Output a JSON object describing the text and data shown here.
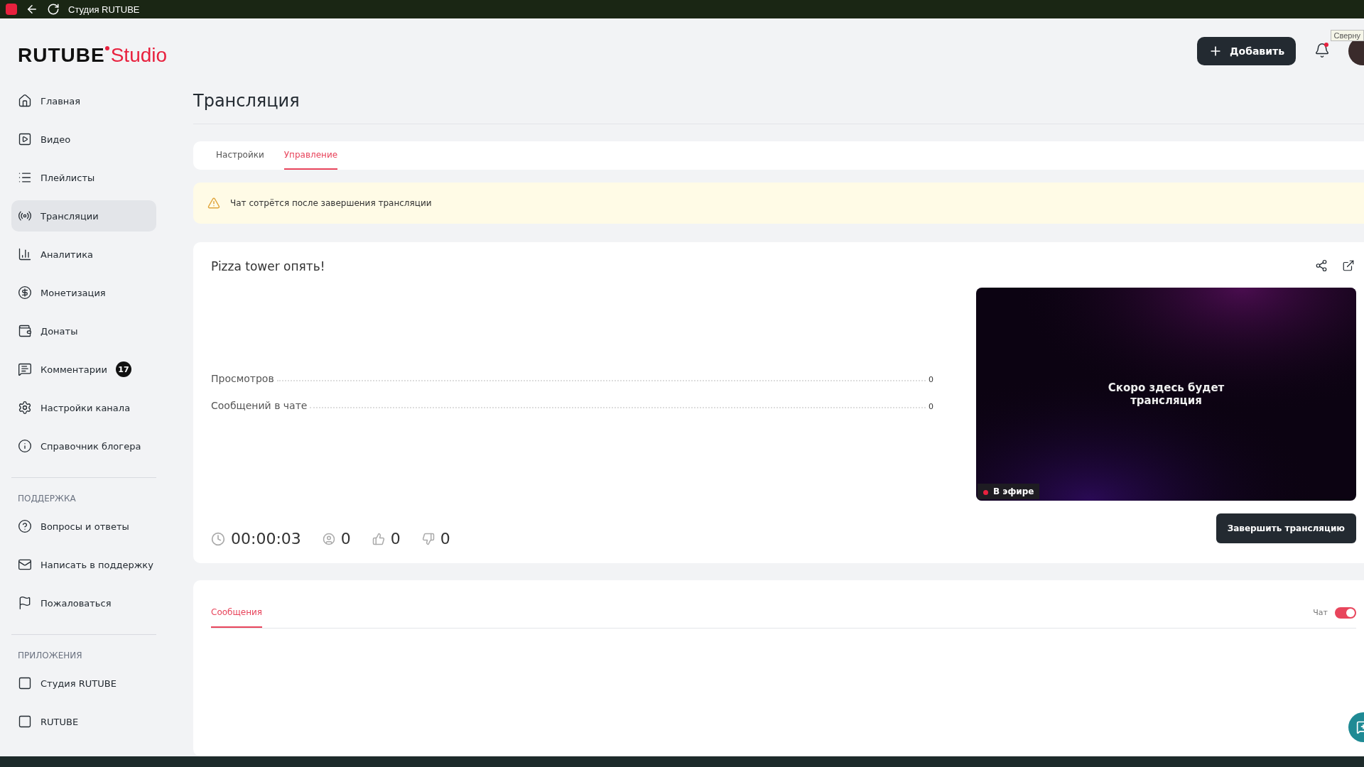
{
  "browser_bar": {
    "title": "Студия RUTUBE",
    "tooltip": "Сверну"
  },
  "header": {
    "logo": {
      "brand": "RUTUBE",
      "product": "Studio"
    },
    "add_button": "Добавить",
    "notifications": {
      "unread": true
    }
  },
  "sidebar": {
    "items": [
      {
        "label": "Главная",
        "selected": false
      },
      {
        "label": "Видео",
        "selected": false
      },
      {
        "label": "Плейлисты",
        "selected": false
      },
      {
        "label": "Трансляции",
        "selected": true
      },
      {
        "label": "Аналитика",
        "selected": false
      },
      {
        "label": "Монетизация",
        "selected": false
      },
      {
        "label": "Донаты",
        "selected": false
      },
      {
        "label": "Комментарии",
        "selected": false,
        "badge": "17"
      },
      {
        "label": "Настройки канала",
        "selected": false
      },
      {
        "label": "Справочник блогера",
        "selected": false
      }
    ],
    "sections": [
      {
        "title": "ПОДДЕРЖКА",
        "items": [
          {
            "label": "Вопросы и ответы",
            "selected": false
          },
          {
            "label": "Написать в поддержку",
            "selected": false
          },
          {
            "label": "Пожаловаться",
            "selected": false
          }
        ]
      },
      {
        "title": "ПРИЛОЖЕНИЯ",
        "items": [
          {
            "label": "Студия RUTUBE",
            "selected": false
          },
          {
            "label": "RUTUBE",
            "selected": false
          }
        ]
      }
    ]
  },
  "page": {
    "title": "Трансляция",
    "tabs": [
      {
        "label": "Настройки",
        "selected": false
      },
      {
        "label": "Управление",
        "selected": true
      }
    ],
    "alert": "Чат сотрётся после завершения трансляции",
    "stream": {
      "title": "Pizza tower опять!",
      "stats": [
        {
          "label": "Просмотров",
          "value": "0"
        },
        {
          "label": "Сообщений в чате",
          "value": "0"
        }
      ],
      "timer": "00:00:03",
      "viewers": "0",
      "likes": "0",
      "dislikes": "0",
      "player": {
        "kind": "picture",
        "message": "Скоро здесь будет трансляция",
        "live_label": "В эфире"
      },
      "end_button": "Завершить трансляцию"
    },
    "chat": {
      "tabs": [
        {
          "label": "Сообщения",
          "selected": true
        }
      ],
      "toggle_label": "Чат",
      "on": true
    }
  }
}
